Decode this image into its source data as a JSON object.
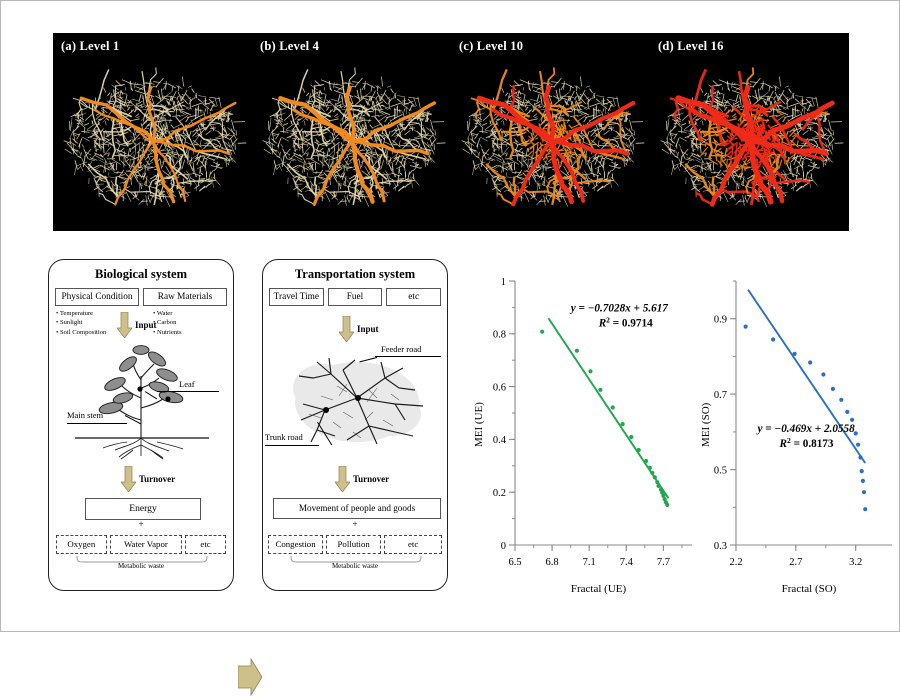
{
  "figure": {
    "maps": {
      "panels": [
        {
          "label": "(a) Level 1",
          "level": 1,
          "red_intensity": 0.06
        },
        {
          "label": "(b) Level 4",
          "level": 4,
          "red_intensity": 0.24
        },
        {
          "label": "(c) Level 10",
          "level": 10,
          "red_intensity": 0.58
        },
        {
          "label": "(d) Level 16",
          "level": 16,
          "red_intensity": 0.92
        }
      ],
      "background_color": "#000000",
      "minor_road_color": "#e8dcae",
      "major_road_color": "#f08a1e",
      "highest_road_color": "#ee2a18"
    },
    "diagram": {
      "biological": {
        "title": "Biological system",
        "inputs": [
          "Physical Condition",
          "Raw Materials"
        ],
        "bullets_left": [
          "Temperature",
          "Sunlight",
          "Soil Composition"
        ],
        "bullets_right": [
          "Water",
          "Carbon",
          "Nutrients"
        ],
        "input_arrow_label": "Input",
        "callouts": [
          "Leaf",
          "Main stem"
        ],
        "turnover_label": "Turnover",
        "output": "Energy",
        "plus": "+",
        "waste": [
          "Oxygen",
          "Water Vapor",
          "etc"
        ],
        "waste_label": "Metabolic waste"
      },
      "transportation": {
        "title": "Transportation system",
        "inputs": [
          "Travel Time",
          "Fuel",
          "etc"
        ],
        "input_arrow_label": "Input",
        "callouts": [
          "Feeder road",
          "Trunk road"
        ],
        "turnover_label": "Turnover",
        "output": "Movement of people and goods",
        "plus": "+",
        "waste": [
          "Congestion",
          "Pollution",
          "etc"
        ],
        "waste_label": "Metabolic waste"
      },
      "arrow_color": "#cfc08a"
    }
  },
  "chart_data": [
    {
      "type": "scatter",
      "id": "UE",
      "xlabel": "Fractal (UE)",
      "ylabel": "MEI (UE)",
      "xlim": [
        6.5,
        7.85
      ],
      "ylim": [
        0,
        1
      ],
      "xticks": [
        6.5,
        6.8,
        7.1,
        7.4,
        7.7
      ],
      "xtick_labels": [
        "6.5",
        "6.8",
        "7.1",
        "7.4",
        "7.7"
      ],
      "yticks": [
        0,
        0.2,
        0.4,
        0.6,
        0.8,
        1
      ],
      "ytick_labels": [
        "0",
        "0.2",
        "0.4",
        "0.6",
        "0.8",
        "1"
      ],
      "minor_xtick_step": 0.15,
      "minor_ytick_step": 0.1,
      "grid": false,
      "series_color": "#1fa84c",
      "equation": "y = −0.7028x + 5.617",
      "r2": "R² = 0.9714",
      "fit": {
        "slope": -0.7028,
        "intercept": 5.617,
        "x_start": 6.77,
        "x_end": 7.74
      },
      "points": [
        [
          6.72,
          0.808
        ],
        [
          7.0,
          0.736
        ],
        [
          7.11,
          0.658
        ],
        [
          7.19,
          0.588
        ],
        [
          7.29,
          0.521
        ],
        [
          7.37,
          0.458
        ],
        [
          7.44,
          0.409
        ],
        [
          7.5,
          0.36
        ],
        [
          7.56,
          0.318
        ],
        [
          7.59,
          0.292
        ],
        [
          7.61,
          0.273
        ],
        [
          7.63,
          0.256
        ],
        [
          7.65,
          0.238
        ],
        [
          7.66,
          0.224
        ],
        [
          7.68,
          0.21
        ],
        [
          7.69,
          0.198
        ],
        [
          7.7,
          0.186
        ],
        [
          7.71,
          0.174
        ],
        [
          7.72,
          0.162
        ],
        [
          7.73,
          0.152
        ]
      ]
    },
    {
      "type": "scatter",
      "id": "SO",
      "xlabel": "Fractal (SO)",
      "ylabel": "MEI (SO)",
      "xlim": [
        2.2,
        3.42
      ],
      "ylim": [
        0.3,
        1.0
      ],
      "xticks": [
        2.2,
        2.7,
        3.2
      ],
      "xtick_labels": [
        "2.2",
        "2.7",
        "3.2"
      ],
      "yticks": [
        0.3,
        0.5,
        0.7,
        0.9
      ],
      "ytick_labels": [
        "0.3",
        "0.5",
        "0.7",
        "0.9"
      ],
      "minor_xtick_step": 0.25,
      "minor_ytick_step": 0.1,
      "grid": false,
      "series_color": "#2a6fc4",
      "equation": "y = −0.469x + 2.0558",
      "r2": "R² = 0.8173",
      "fit": {
        "slope": -0.469,
        "intercept": 2.0558,
        "x_start": 2.3,
        "x_end": 3.28
      },
      "points": [
        [
          2.28,
          0.879
        ],
        [
          2.51,
          0.845
        ],
        [
          2.69,
          0.807
        ],
        [
          2.82,
          0.784
        ],
        [
          2.93,
          0.752
        ],
        [
          3.01,
          0.714
        ],
        [
          3.08,
          0.685
        ],
        [
          3.13,
          0.653
        ],
        [
          3.17,
          0.632
        ],
        [
          3.2,
          0.596
        ],
        [
          3.22,
          0.566
        ],
        [
          3.24,
          0.532
        ],
        [
          3.25,
          0.496
        ],
        [
          3.26,
          0.47
        ],
        [
          3.27,
          0.44
        ],
        [
          3.28,
          0.395
        ]
      ]
    }
  ]
}
